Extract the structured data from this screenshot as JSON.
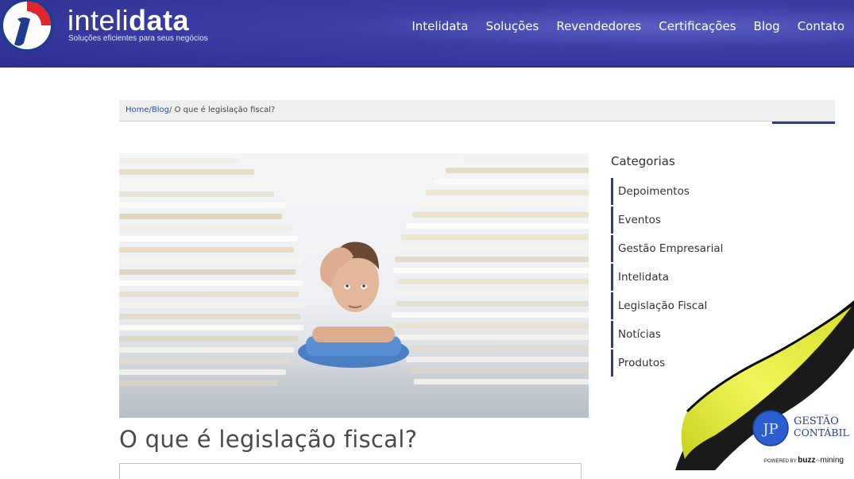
{
  "header": {
    "brand_light": "inteli",
    "brand_bold": "data",
    "tagline": "Soluções eficientes para seus negócios",
    "nav": [
      "Intelidata",
      "Soluções",
      "Revendedores",
      "Certificações",
      "Blog",
      "Contato"
    ],
    "colors": {
      "header_bg": "#3c3fa6",
      "logo_red": "#e0252b",
      "logo_blue": "#1f3b8f"
    },
    "logo_icon": "intelidata-i-logo"
  },
  "breadcrumb": {
    "home": "Home",
    "sep1": "/",
    "blog": "Blog",
    "sep2": "/",
    "current": "O que é legislação fiscal?"
  },
  "post": {
    "title": "O que é legislação fiscal?",
    "image_icon": "stressed-man-paper-stacks-photo"
  },
  "sidebar": {
    "heading": "Categorias",
    "categories": [
      "Depoimentos",
      "Eventos",
      "Gestão Empresarial",
      "Intelidata",
      "Legislação Fiscal",
      "Notícias",
      "Produtos"
    ]
  },
  "ad": {
    "line1": "GESTÃO",
    "line2": "CONTÁBIL",
    "monogram": "JP",
    "powered_by": "POWERED BY",
    "buzz": "buzz",
    "mining": "mining",
    "colors": {
      "peel_yellow": "#e6ee3a",
      "badge_blue": "#2b5fd0"
    }
  }
}
